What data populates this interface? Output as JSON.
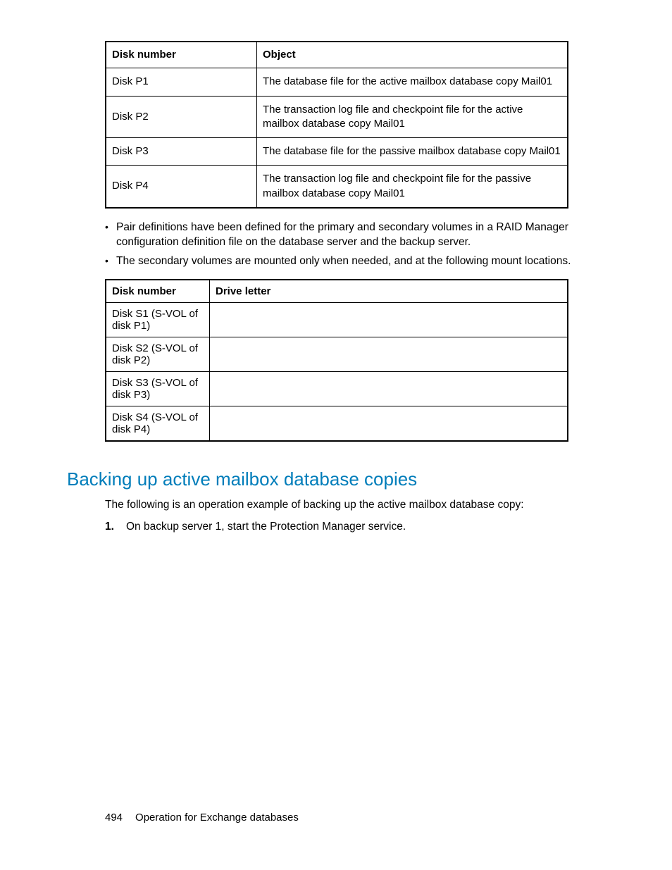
{
  "table1": {
    "headers": [
      "Disk number",
      "Object"
    ],
    "rows": [
      [
        "Disk P1",
        "The database file for the active mailbox database copy Mail01"
      ],
      [
        "Disk P2",
        "The transaction log file and checkpoint file for the active mailbox database copy Mail01"
      ],
      [
        "Disk P3",
        "The database file for the passive mailbox database copy Mail01"
      ],
      [
        "Disk P4",
        "The transaction log file and checkpoint file for the passive mailbox database copy Mail01"
      ]
    ]
  },
  "bullets": [
    "Pair definitions have been defined for the primary and secondary volumes in a RAID Manager configuration definition file on the database server and the backup server.",
    "The secondary volumes are mounted only when needed, and at the following mount locations."
  ],
  "table2": {
    "headers": [
      "Disk number",
      "Drive letter"
    ],
    "rows": [
      [
        "Disk S1 (S-VOL of disk P1)",
        ""
      ],
      [
        "Disk S2 (S-VOL of disk P2)",
        ""
      ],
      [
        "Disk S3 (S-VOL of disk P3)",
        ""
      ],
      [
        "Disk S4 (S-VOL of disk P4)",
        ""
      ]
    ]
  },
  "section_heading": "Backing up active mailbox database copies",
  "section_intro": "The following is an operation example of backing up the active mailbox database copy:",
  "steps": [
    "On backup server 1, start the Protection Manager service."
  ],
  "footer": {
    "page_number": "494",
    "chapter": "Operation for Exchange databases"
  }
}
